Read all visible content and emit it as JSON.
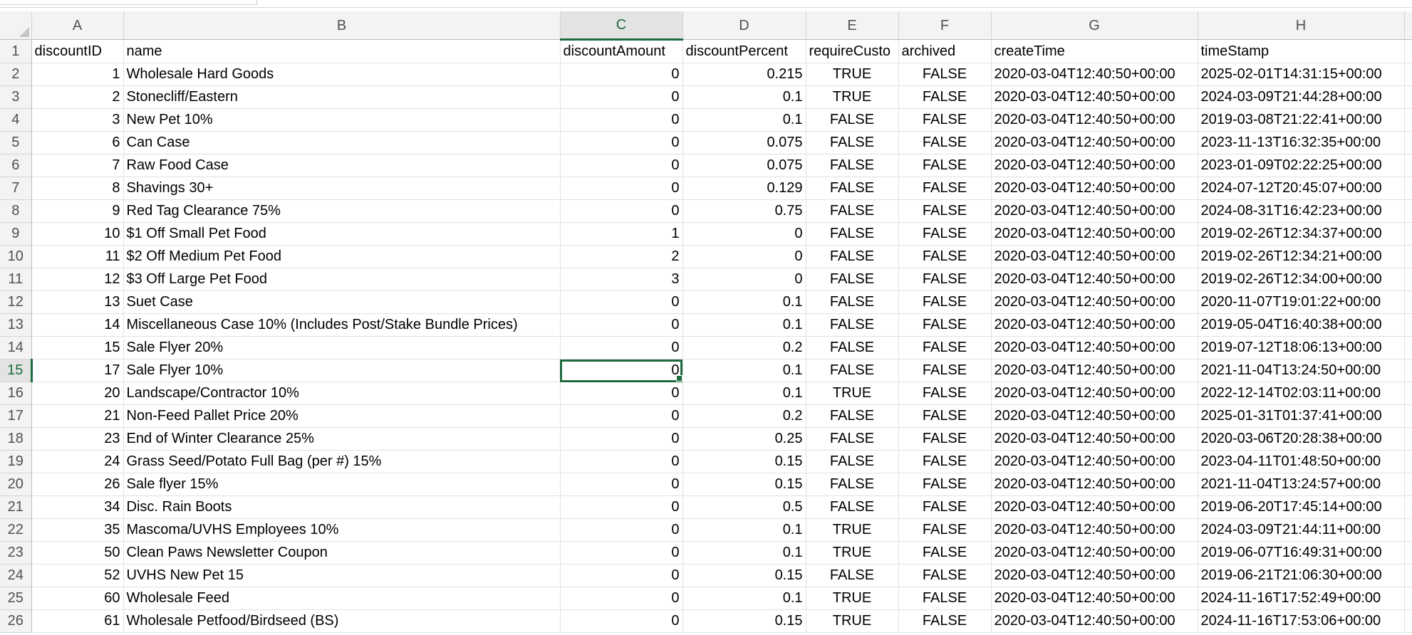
{
  "sheet": {
    "columns": [
      "A",
      "B",
      "C",
      "D",
      "E",
      "F",
      "G",
      "H"
    ],
    "selected_column": "C",
    "selected_row": 15,
    "headers": [
      "discountID",
      "name",
      "discountAmount",
      "discountPercent",
      "requireCusto",
      "archived",
      "createTime",
      "timeStamp"
    ],
    "rows": [
      {
        "n": 2,
        "cells": [
          "1",
          "Wholesale Hard Goods",
          "0",
          "0.215",
          "TRUE",
          "FALSE",
          "2020-03-04T12:40:50+00:00",
          "2025-02-01T14:31:15+00:00"
        ]
      },
      {
        "n": 3,
        "cells": [
          "2",
          "Stonecliff/Eastern",
          "0",
          "0.1",
          "TRUE",
          "FALSE",
          "2020-03-04T12:40:50+00:00",
          "2024-03-09T21:44:28+00:00"
        ]
      },
      {
        "n": 4,
        "cells": [
          "3",
          "New Pet 10%",
          "0",
          "0.1",
          "FALSE",
          "FALSE",
          "2020-03-04T12:40:50+00:00",
          "2019-03-08T21:22:41+00:00"
        ]
      },
      {
        "n": 5,
        "cells": [
          "6",
          "Can Case",
          "0",
          "0.075",
          "FALSE",
          "FALSE",
          "2020-03-04T12:40:50+00:00",
          "2023-11-13T16:32:35+00:00"
        ]
      },
      {
        "n": 6,
        "cells": [
          "7",
          "Raw Food Case",
          "0",
          "0.075",
          "FALSE",
          "FALSE",
          "2020-03-04T12:40:50+00:00",
          "2023-01-09T02:22:25+00:00"
        ]
      },
      {
        "n": 7,
        "cells": [
          "8",
          "Shavings 30+",
          "0",
          "0.129",
          "FALSE",
          "FALSE",
          "2020-03-04T12:40:50+00:00",
          "2024-07-12T20:45:07+00:00"
        ]
      },
      {
        "n": 8,
        "cells": [
          "9",
          "Red Tag Clearance 75%",
          "0",
          "0.75",
          "FALSE",
          "FALSE",
          "2020-03-04T12:40:50+00:00",
          "2024-08-31T16:42:23+00:00"
        ]
      },
      {
        "n": 9,
        "cells": [
          "10",
          "$1 Off Small Pet Food",
          "1",
          "0",
          "FALSE",
          "FALSE",
          "2020-03-04T12:40:50+00:00",
          "2019-02-26T12:34:37+00:00"
        ]
      },
      {
        "n": 10,
        "cells": [
          "11",
          "$2 Off Medium Pet Food",
          "2",
          "0",
          "FALSE",
          "FALSE",
          "2020-03-04T12:40:50+00:00",
          "2019-02-26T12:34:21+00:00"
        ]
      },
      {
        "n": 11,
        "cells": [
          "12",
          "$3 Off Large Pet Food",
          "3",
          "0",
          "FALSE",
          "FALSE",
          "2020-03-04T12:40:50+00:00",
          "2019-02-26T12:34:00+00:00"
        ]
      },
      {
        "n": 12,
        "cells": [
          "13",
          "Suet Case",
          "0",
          "0.1",
          "FALSE",
          "FALSE",
          "2020-03-04T12:40:50+00:00",
          "2020-11-07T19:01:22+00:00"
        ]
      },
      {
        "n": 13,
        "cells": [
          "14",
          "Miscellaneous Case 10% (Includes Post/Stake Bundle Prices)",
          "0",
          "0.1",
          "FALSE",
          "FALSE",
          "2020-03-04T12:40:50+00:00",
          "2019-05-04T16:40:38+00:00"
        ]
      },
      {
        "n": 14,
        "cells": [
          "15",
          "Sale Flyer 20%",
          "0",
          "0.2",
          "FALSE",
          "FALSE",
          "2020-03-04T12:40:50+00:00",
          "2019-07-12T18:06:13+00:00"
        ]
      },
      {
        "n": 15,
        "cells": [
          "17",
          "Sale Flyer 10%",
          "0",
          "0.1",
          "FALSE",
          "FALSE",
          "2020-03-04T12:40:50+00:00",
          "2021-11-04T13:24:50+00:00"
        ]
      },
      {
        "n": 16,
        "cells": [
          "20",
          "Landscape/Contractor  10%",
          "0",
          "0.1",
          "TRUE",
          "FALSE",
          "2020-03-04T12:40:50+00:00",
          "2022-12-14T02:03:11+00:00"
        ]
      },
      {
        "n": 17,
        "cells": [
          "21",
          "Non-Feed Pallet Price 20%",
          "0",
          "0.2",
          "FALSE",
          "FALSE",
          "2020-03-04T12:40:50+00:00",
          "2025-01-31T01:37:41+00:00"
        ]
      },
      {
        "n": 18,
        "cells": [
          "23",
          "End of Winter Clearance 25%",
          "0",
          "0.25",
          "FALSE",
          "FALSE",
          "2020-03-04T12:40:50+00:00",
          "2020-03-06T20:28:38+00:00"
        ]
      },
      {
        "n": 19,
        "cells": [
          "24",
          "Grass Seed/Potato Full Bag (per #) 15%",
          "0",
          "0.15",
          "FALSE",
          "FALSE",
          "2020-03-04T12:40:50+00:00",
          "2023-04-11T01:48:50+00:00"
        ]
      },
      {
        "n": 20,
        "cells": [
          "26",
          "Sale flyer 15%",
          "0",
          "0.15",
          "FALSE",
          "FALSE",
          "2020-03-04T12:40:50+00:00",
          "2021-11-04T13:24:57+00:00"
        ]
      },
      {
        "n": 21,
        "cells": [
          "34",
          "Disc. Rain Boots",
          "0",
          "0.5",
          "FALSE",
          "FALSE",
          "2020-03-04T12:40:50+00:00",
          "2019-06-20T17:45:14+00:00"
        ]
      },
      {
        "n": 22,
        "cells": [
          "35",
          "Mascoma/UVHS Employees 10%",
          "0",
          "0.1",
          "TRUE",
          "FALSE",
          "2020-03-04T12:40:50+00:00",
          "2024-03-09T21:44:11+00:00"
        ]
      },
      {
        "n": 23,
        "cells": [
          "50",
          "Clean Paws Newsletter Coupon",
          "0",
          "0.1",
          "TRUE",
          "FALSE",
          "2020-03-04T12:40:50+00:00",
          "2019-06-07T16:49:31+00:00"
        ]
      },
      {
        "n": 24,
        "cells": [
          "52",
          "UVHS New Pet 15",
          "0",
          "0.15",
          "FALSE",
          "FALSE",
          "2020-03-04T12:40:50+00:00",
          "2019-06-21T21:06:30+00:00"
        ]
      },
      {
        "n": 25,
        "cells": [
          "60",
          "Wholesale Feed",
          "0",
          "0.1",
          "TRUE",
          "FALSE",
          "2020-03-04T12:40:50+00:00",
          "2024-11-16T17:52:49+00:00"
        ]
      },
      {
        "n": 26,
        "cells": [
          "61",
          "Wholesale Petfood/Birdseed (BS)",
          "0",
          "0.15",
          "TRUE",
          "FALSE",
          "2020-03-04T12:40:50+00:00",
          "2024-11-16T17:53:06+00:00"
        ]
      }
    ]
  },
  "colors": {
    "selection_green": "#1f6b41",
    "header_bg": "#f3f3f3",
    "gridline": "#e1e1e1"
  }
}
